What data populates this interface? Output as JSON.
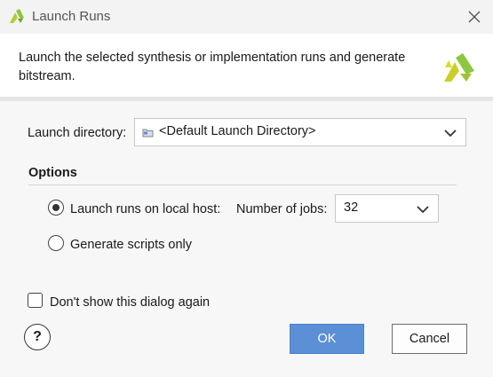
{
  "window": {
    "title": "Launch Runs",
    "description": "Launch the selected synthesis or implementation runs and generate bitstream."
  },
  "launch_directory": {
    "label": "Launch directory:",
    "value": "<Default Launch Directory>"
  },
  "options": {
    "section_title": "Options",
    "local_host_label": "Launch runs on local host:",
    "local_host_selected": true,
    "jobs_label": "Number of jobs:",
    "jobs_value": "32",
    "scripts_only_label": "Generate scripts only",
    "scripts_only_selected": false
  },
  "footer": {
    "dont_show_label": "Don't show this dialog again",
    "dont_show_checked": false,
    "help_label": "?",
    "ok_label": "OK",
    "cancel_label": "Cancel"
  },
  "colors": {
    "ok_button": "#5b8fd6",
    "logo_green": "#8dc63f",
    "logo_yellow": "#d6de23"
  },
  "icons": [
    "vivado-logo-icon",
    "close-icon",
    "folder-icon",
    "chevron-down-icon",
    "help-icon"
  ]
}
